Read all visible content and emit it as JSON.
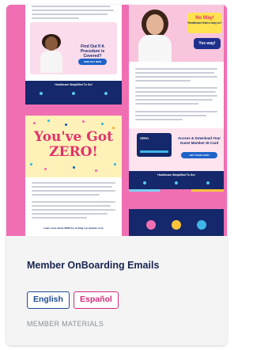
{
  "card": {
    "title": "Member OnBoarding Emails",
    "tags": [
      "English",
      "Español"
    ],
    "category": "MEMBER MATERIALS"
  },
  "preview": {
    "email1": {
      "question": "Find Out If A Procedure is Covered?",
      "button": "FIND OUT NOW",
      "footer": "Healthcare Simplified To Go!"
    },
    "email2": {
      "bubble_title": "No Way!",
      "bubble_subtitle": "Healthcare that's easy to?",
      "yes_button": "Yes way!",
      "access_title": "Access & Download Your Guest Member ID Card",
      "id_button": "GET YOUR CARD",
      "card_logo": "ZERO",
      "footer": "Healthcare Simplified To Go!"
    },
    "email3": {
      "headline": "You've Got ZERO!",
      "learn_more": "Learn more about ZERO by visiting our website or by"
    }
  },
  "colors": {
    "preview_background": "#f06fb3",
    "brand_navy": "#14286b",
    "english_tag": "#1d4d91",
    "spanish_tag": "#d42b7a",
    "category_text": "#8a8f99"
  }
}
